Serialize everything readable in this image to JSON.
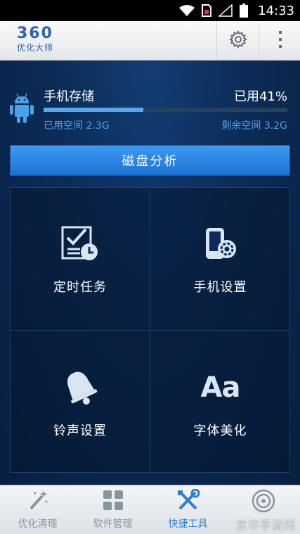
{
  "status_bar": {
    "time": "14:33"
  },
  "header": {
    "logo_number": "360",
    "logo_subtitle": "优化大师",
    "settings_icon": "gear-icon",
    "more_icon": "more-vertical-icon"
  },
  "storage": {
    "icon": "android-icon",
    "title": "手机存储",
    "used_percent_label": "已用41%",
    "used_fraction": 0.41,
    "used_label": "已用空间 2.3G",
    "free_label": "剩余空间 3.2G"
  },
  "analyze_button": {
    "label": "磁盘分析"
  },
  "tools": [
    {
      "label": "定时任务",
      "icon": "scheduled-task-icon"
    },
    {
      "label": "手机设置",
      "icon": "phone-settings-icon"
    },
    {
      "label": "铃声设置",
      "icon": "bell-icon"
    },
    {
      "label": "字体美化",
      "icon": "font-icon",
      "glyph": "Aa"
    }
  ],
  "bottom_nav": [
    {
      "label": "优化清理",
      "icon": "magic-wand-icon",
      "active": false
    },
    {
      "label": "软件管理",
      "icon": "grid-icon",
      "active": false
    },
    {
      "label": "快捷工具",
      "icon": "tools-icon",
      "active": true
    },
    {
      "label": "",
      "icon": "radar-icon",
      "active": false
    }
  ],
  "watermark": "京华手游网",
  "colors": {
    "accent": "#2d7fd3",
    "button_blue": "#2a86e6",
    "bar_fill": "#5aa8ea",
    "android_green": "#4aa3e8"
  }
}
